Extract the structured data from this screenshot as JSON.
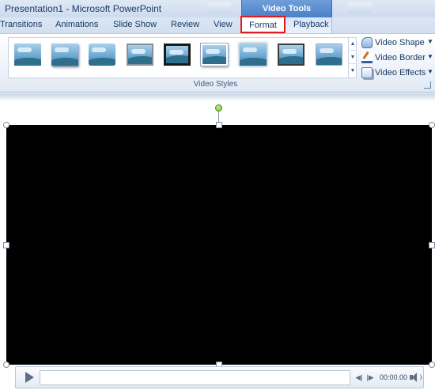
{
  "window": {
    "title": "Presentation1 - Microsoft PowerPoint"
  },
  "contextual_tab_group": {
    "label": "Video Tools"
  },
  "tabs": [
    {
      "label": "Transitions"
    },
    {
      "label": "Animations"
    },
    {
      "label": "Slide Show"
    },
    {
      "label": "Review"
    },
    {
      "label": "View"
    },
    {
      "label": "Format",
      "selected": true,
      "highlighted_red": true
    },
    {
      "label": "Playback"
    }
  ],
  "ribbon": {
    "video_styles_gallery": {
      "group_label": "Video Styles",
      "thumbnails": [
        {
          "name": "style-simple"
        },
        {
          "name": "style-shadow"
        },
        {
          "name": "style-soft-edge"
        },
        {
          "name": "style-gray-frame"
        },
        {
          "name": "style-black-frame"
        },
        {
          "name": "style-white-frame"
        },
        {
          "name": "style-glow"
        },
        {
          "name": "style-thick-frame"
        },
        {
          "name": "style-bevel"
        }
      ],
      "scroll_icons": [
        "up-arrow-icon",
        "down-arrow-icon",
        "more-icon"
      ]
    },
    "commands": [
      {
        "label": "Video Shape",
        "icon": "video-shape-icon"
      },
      {
        "label": "Video Border",
        "icon": "video-border-icon"
      },
      {
        "label": "Video Effects",
        "icon": "video-effects-icon"
      }
    ]
  },
  "player": {
    "time": "00:00.00",
    "icons": [
      "play-icon",
      "step-back-icon",
      "step-forward-icon",
      "volume-icon"
    ]
  },
  "colors": {
    "contextual_accent": "#4a7fc8",
    "highlight_box": "#e01b1b",
    "video_background": "#000000",
    "rotate_handle": "#6dbf2a"
  }
}
